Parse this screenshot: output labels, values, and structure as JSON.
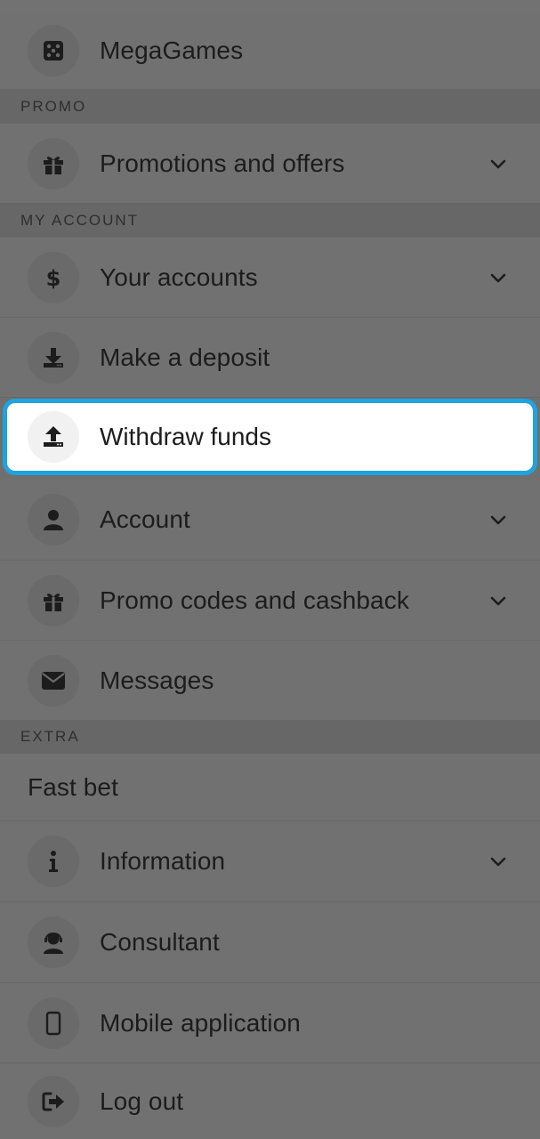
{
  "menu": {
    "megagames": {
      "label": "MegaGames",
      "icon": "dice-icon"
    },
    "section_promo": "PROMO",
    "promotions": {
      "label": "Promotions and offers",
      "icon": "gift-icon",
      "expandable": true
    },
    "section_account": "MY ACCOUNT",
    "your_accounts": {
      "label": "Your accounts",
      "icon": "dollar-icon",
      "expandable": true
    },
    "deposit": {
      "label": "Make a deposit",
      "icon": "download-icon"
    },
    "withdraw": {
      "label": "Withdraw funds",
      "icon": "upload-icon",
      "highlighted": true
    },
    "account": {
      "label": "Account",
      "icon": "user-icon",
      "expandable": true
    },
    "promo_codes": {
      "label": "Promo codes and cashback",
      "icon": "gift-icon",
      "expandable": true
    },
    "messages": {
      "label": "Messages",
      "icon": "envelope-icon"
    },
    "section_extra": "EXTRA",
    "fast_bet": {
      "label": "Fast bet"
    },
    "information": {
      "label": "Information",
      "icon": "info-icon",
      "expandable": true
    },
    "consultant": {
      "label": "Consultant",
      "icon": "headset-user-icon"
    },
    "mobile_app": {
      "label": "Mobile application",
      "icon": "smartphone-icon"
    },
    "logout": {
      "label": "Log out",
      "icon": "sign-out-icon"
    }
  },
  "colors": {
    "highlight_border": "#1ea3e0",
    "overlay_bg": "#717171",
    "section_bg": "#676767"
  }
}
